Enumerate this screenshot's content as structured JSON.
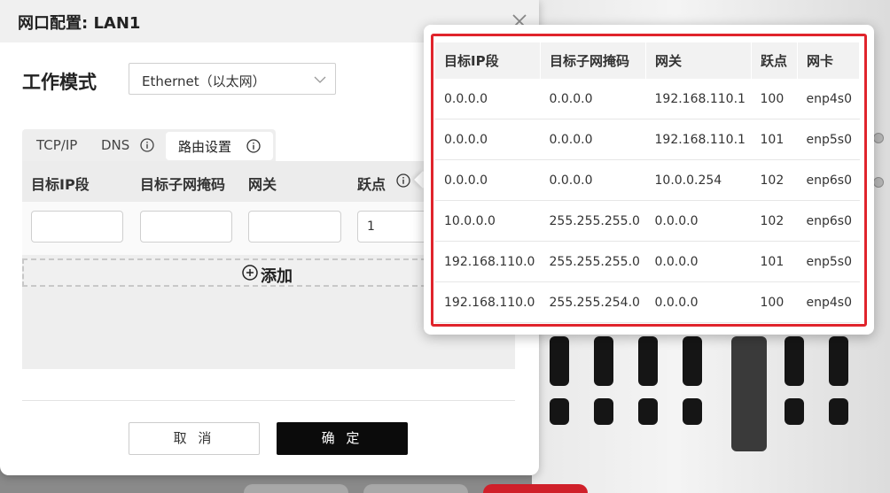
{
  "dialog": {
    "title": "网口配置: LAN1",
    "mode_label": "工作模式",
    "mode_value": "Ethernet（以太网）",
    "tabs": [
      {
        "label": "TCP/IP"
      },
      {
        "label": "DNS"
      },
      {
        "label": "路由设置"
      }
    ],
    "route_columns": [
      "目标IP段",
      "目标子网掩码",
      "网关",
      "跃点"
    ],
    "inputs": {
      "target_ip": "",
      "subnet_mask": "",
      "gateway": "",
      "metric": "1"
    },
    "add_label": "添加",
    "cancel_label": "取 消",
    "ok_label": "确 定"
  },
  "popover": {
    "columns": [
      "目标IP段",
      "目标子网掩码",
      "网关",
      "跃点",
      "网卡"
    ],
    "rows": [
      [
        "0.0.0.0",
        "0.0.0.0",
        "192.168.110.1",
        "100",
        "enp4s0"
      ],
      [
        "0.0.0.0",
        "0.0.0.0",
        "192.168.110.1",
        "101",
        "enp5s0"
      ],
      [
        "0.0.0.0",
        "0.0.0.0",
        "10.0.0.254",
        "102",
        "enp6s0"
      ],
      [
        "10.0.0.0",
        "255.255.255.0",
        "0.0.0.0",
        "102",
        "enp6s0"
      ],
      [
        "192.168.110.0",
        "255.255.255.0",
        "0.0.0.0",
        "101",
        "enp5s0"
      ],
      [
        "192.168.110.0",
        "255.255.254.0",
        "0.0.0.0",
        "100",
        "enp4s0"
      ]
    ]
  },
  "colors": {
    "highlight": "#e0242c",
    "ok_button": "#0b0b0b"
  },
  "icons": {
    "close": "close-icon",
    "dropdown": "chevron-down-icon",
    "info": "info-icon",
    "add": "plus-circle-icon"
  }
}
